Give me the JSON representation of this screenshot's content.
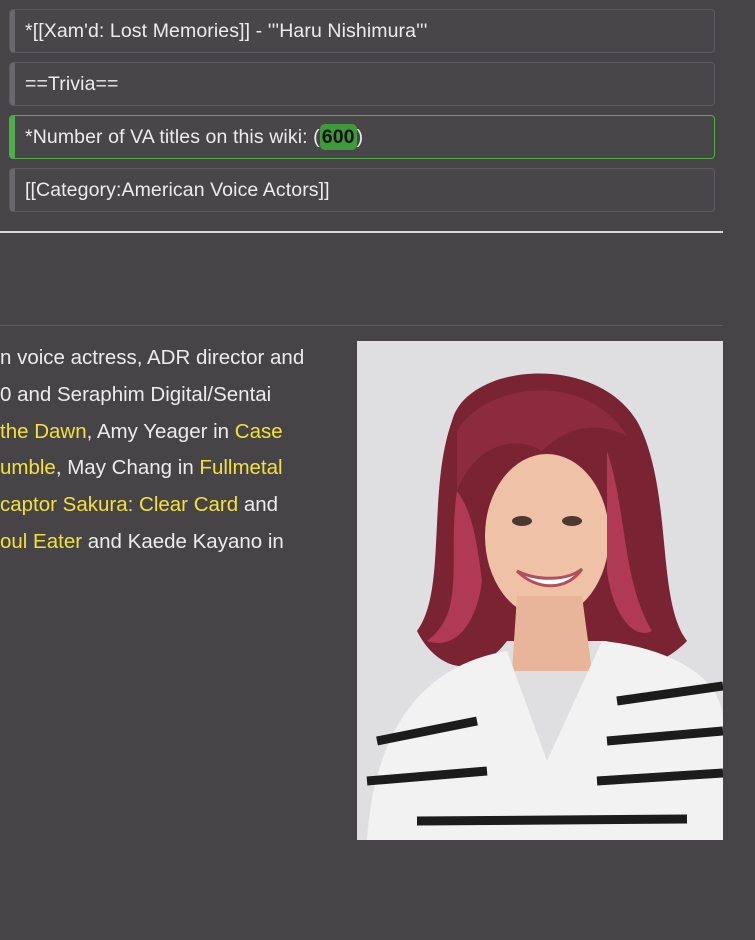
{
  "diff": {
    "lines": [
      {
        "text": "*[[Xam'd: Lost Memories]] - '''Haru Nishimura'''"
      },
      {
        "text": "==Trivia=="
      },
      {
        "prefix": "*Number of VA titles on this wiki: (",
        "highlight": "600",
        "suffix": ")"
      },
      {
        "text": "[[Category:American Voice Actors]]"
      }
    ]
  },
  "article": {
    "l1": "n voice actress, ADR director and",
    "l2": "0 and Seraphim Digital/Sentai",
    "l3a": "the Dawn",
    "l3b": ", Amy Yeager in ",
    "l3c": "Case",
    "l4a": "umble",
    "l4b": ", May Chang in ",
    "l4c": "Fullmetal",
    "l5a": "captor Sakura: Clear Card",
    "l5b": " and",
    "l6a": "oul Eater",
    "l6b": " and Kaede Kayano in"
  },
  "colors": {
    "background": "#464447",
    "added_border": "#4fae4a",
    "link": "#f3e03c"
  }
}
